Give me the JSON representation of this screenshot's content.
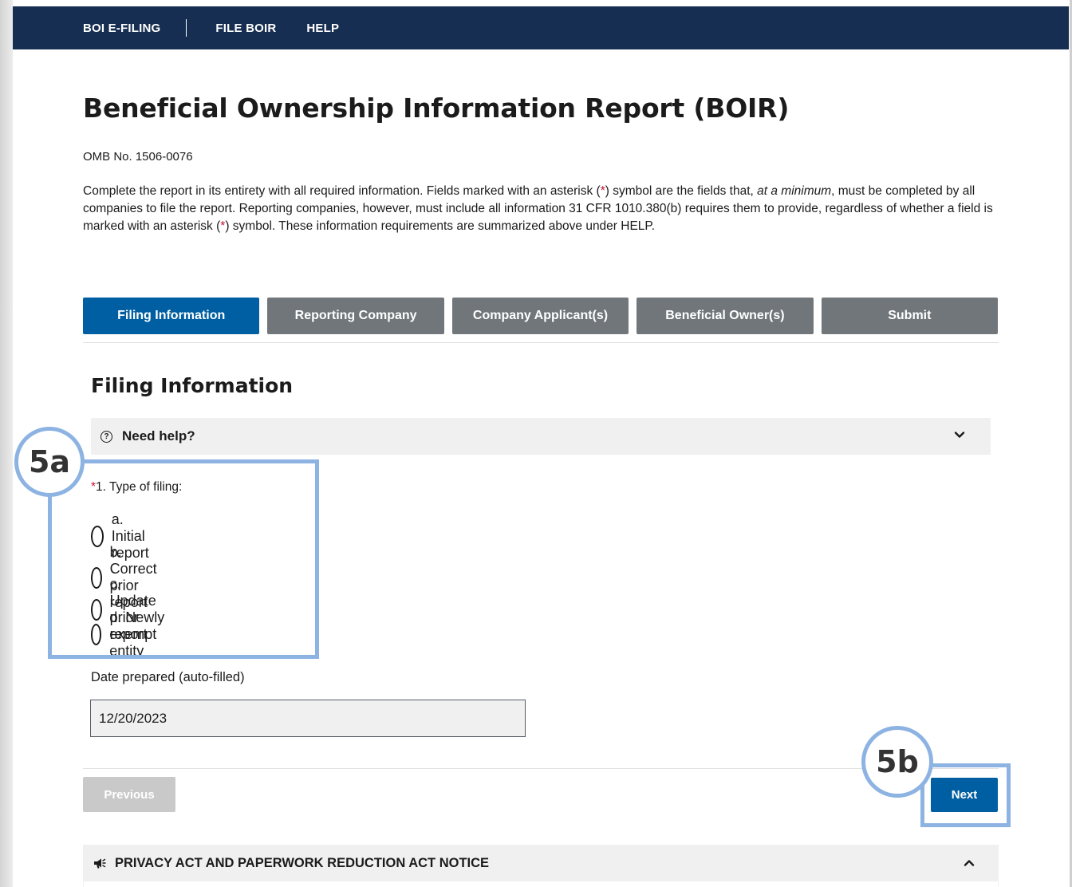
{
  "nav": {
    "brand": "BOI E-FILING",
    "file_boir": "FILE BOIR",
    "help": "HELP"
  },
  "page": {
    "title": "Beneficial Ownership Information Report (BOIR)",
    "omb": "OMB No. 1506-0076",
    "intro": {
      "part1": "Complete the report in its entirety with all required information. Fields marked with an asterisk (",
      "star": "*",
      "part2": ") symbol are the fields that, ",
      "emphasis": "at a minimum",
      "part3": ", must be completed by all companies to file the report. Reporting companies, however, must include all information 31 CFR 1010.380(b) requires them to provide, regardless of whether a field is marked with an asterisk (",
      "part4": ") symbol. These information requirements are summarized above under HELP."
    }
  },
  "steps": [
    {
      "label": "Filing Information",
      "active": true
    },
    {
      "label": "Reporting Company",
      "active": false
    },
    {
      "label": "Company Applicant(s)",
      "active": false
    },
    {
      "label": "Beneficial Owner(s)",
      "active": false
    },
    {
      "label": "Submit",
      "active": false
    }
  ],
  "section": {
    "title": "Filing Information",
    "help_label": "Need help?"
  },
  "filing_type": {
    "required_mark": "*",
    "label": "1. Type of filing:",
    "options": [
      "a. Initial report",
      "b. Correct prior report",
      "c. Update prior report",
      "d. Newly exempt entity"
    ]
  },
  "date_prepared": {
    "label": "Date prepared (auto-filled)",
    "value": "12/20/2023"
  },
  "buttons": {
    "previous": "Previous",
    "next": "Next"
  },
  "privacy": {
    "label": "PRIVACY ACT AND PAPERWORK REDUCTION ACT NOTICE"
  },
  "annotations": {
    "a": "5a",
    "b": "5b"
  },
  "colors": {
    "nav_bg": "#162e51",
    "primary": "#005ea2",
    "step_inactive": "#71767a",
    "required": "#c41230",
    "annotation": "#8db3e2"
  }
}
